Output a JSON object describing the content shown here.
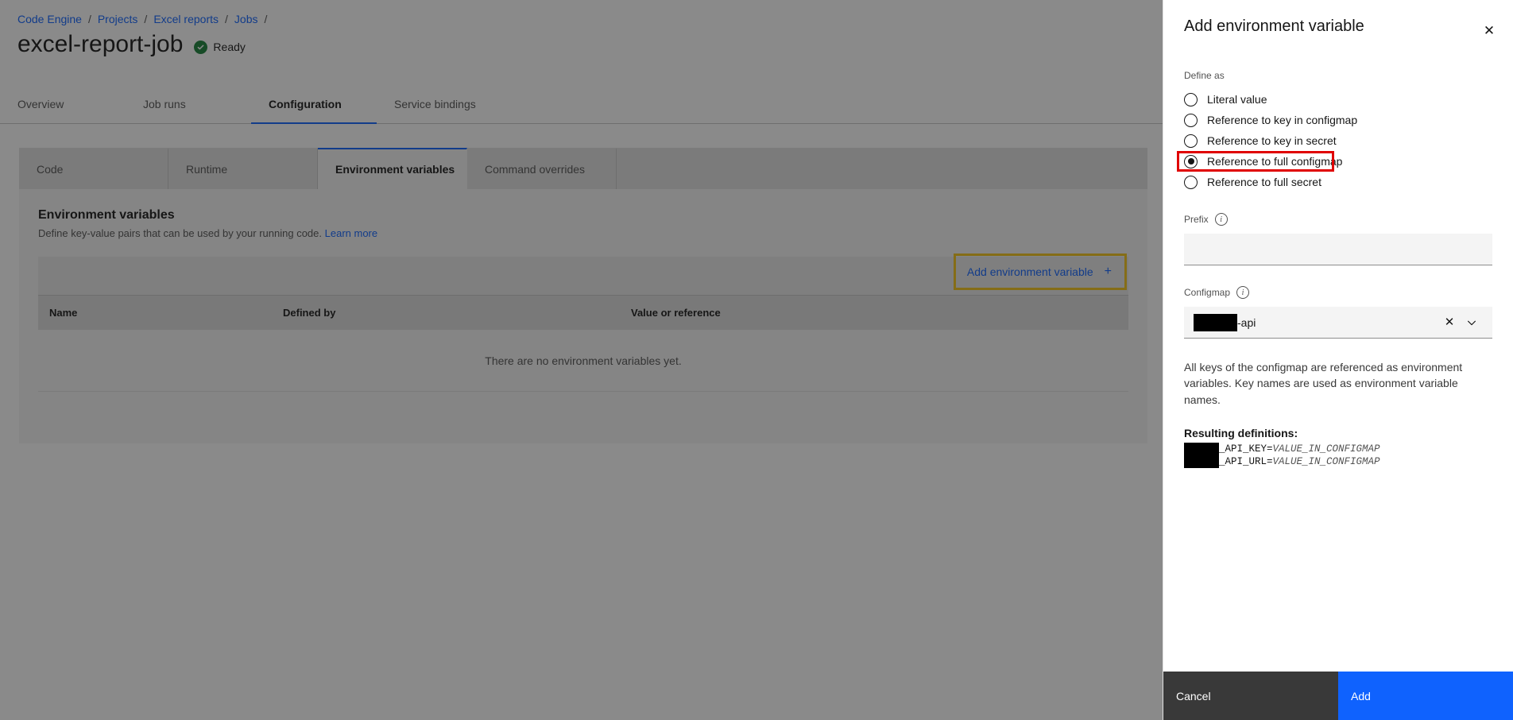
{
  "breadcrumb": {
    "items": [
      {
        "label": "Code Engine"
      },
      {
        "label": "Projects"
      },
      {
        "label": "Excel reports"
      },
      {
        "label": "Jobs"
      }
    ],
    "separator": "/"
  },
  "header": {
    "title": "excel-report-job",
    "status": "Ready",
    "status_color": "#198038"
  },
  "primary_tabs": [
    {
      "label": "Overview",
      "selected": false
    },
    {
      "label": "Job runs",
      "selected": false
    },
    {
      "label": "Configuration",
      "selected": true
    },
    {
      "label": "Service bindings",
      "selected": false
    }
  ],
  "sub_tabs": [
    {
      "label": "Code",
      "selected": false
    },
    {
      "label": "Runtime",
      "selected": false
    },
    {
      "label": "Environment variables",
      "selected": true
    },
    {
      "label": "Command overrides",
      "selected": false
    }
  ],
  "section": {
    "title": "Environment variables",
    "description": "Define key-value pairs that can be used by your running code.",
    "learn_more": "Learn more"
  },
  "toolbar": {
    "add_label": "Add environment variable",
    "plus_icon": "+",
    "highlight_color": "#f5c518"
  },
  "table": {
    "columns": [
      "Name",
      "Defined by",
      "Value or reference"
    ],
    "empty_message": "There are no environment variables yet."
  },
  "panel": {
    "title": "Add environment variable",
    "close_icon": "✕",
    "define_as": {
      "label": "Define as",
      "options": [
        {
          "label": "Literal value",
          "checked": false,
          "highlighted": false
        },
        {
          "label": "Reference to key in configmap",
          "checked": false,
          "highlighted": false
        },
        {
          "label": "Reference to key in secret",
          "checked": false,
          "highlighted": false
        },
        {
          "label": "Reference to full configmap",
          "checked": true,
          "highlighted": true
        },
        {
          "label": "Reference to full secret",
          "checked": false,
          "highlighted": false
        }
      ],
      "highlight_color": "#e00000"
    },
    "prefix": {
      "label": "Prefix",
      "value": "",
      "placeholder": "",
      "info_icon": "i"
    },
    "configmap": {
      "label": "Configmap",
      "info_icon": "i",
      "value_redacted": true,
      "value_suffix": "-api",
      "clear_icon": "✕",
      "caret_icon": "⌄"
    },
    "note": "All keys of the configmap are referenced as environment variables. Key names are used as environment variable names.",
    "definitions_label": "Resulting definitions:",
    "definitions": [
      {
        "redacted": true,
        "key": "_API_KEY=",
        "value": "VALUE_IN_CONFIGMAP"
      },
      {
        "redacted": true,
        "key": "_API_URL=",
        "value": "VALUE_IN_CONFIGMAP"
      }
    ],
    "footer": {
      "cancel_label": "Cancel",
      "add_label": "Add",
      "add_color": "#0f62fe"
    }
  }
}
